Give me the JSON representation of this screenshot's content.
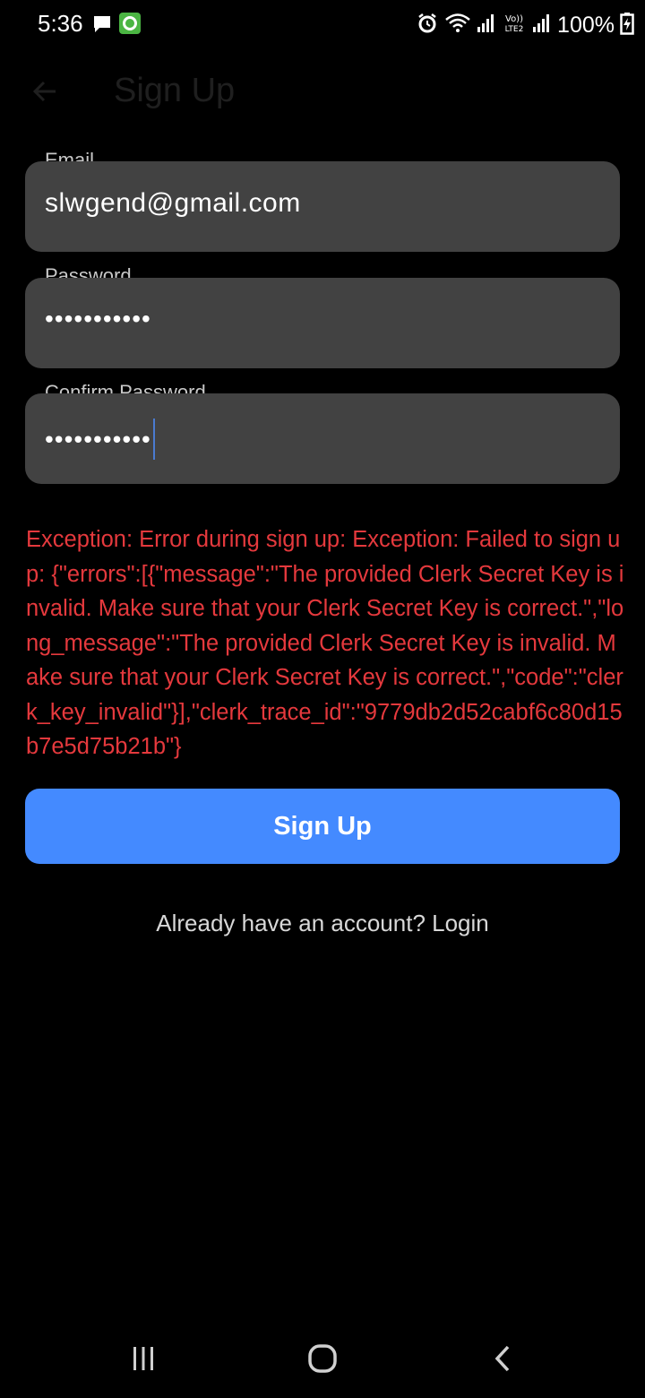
{
  "status_bar": {
    "time": "5:36",
    "battery": "100%",
    "icons": [
      "message-icon",
      "app-notification-icon",
      "alarm-icon",
      "wifi-icon",
      "signal-icon",
      "volte-icon",
      "signal-icon-2",
      "battery-charging-icon"
    ]
  },
  "app_bar": {
    "back_icon": "arrow-left-icon",
    "title": "Sign Up"
  },
  "form": {
    "email_label": "Email",
    "email_value": "slwgend@gmail.com",
    "password_label": "Password",
    "password_value": "•••••••••••",
    "confirm_label": "Confirm Password",
    "confirm_value": "•••••••••••"
  },
  "error": {
    "message": "Exception: Error during sign up: Exception: Failed to sign up: {\"errors\":[{\"message\":\"The provided Clerk Secret Key is invalid. Make sure that your Clerk Secret Key is correct.\",\"long_message\":\"The provided Clerk Secret Key is invalid. Make sure that your Clerk Secret Key is correct.\",\"code\":\"clerk_key_invalid\"}],\"clerk_trace_id\":\"9779db2d52cabf6c80d15b7e5d75b21b\"}"
  },
  "actions": {
    "signup_label": "Sign Up",
    "login_prompt": "Already have an account? Login"
  },
  "nav_bar": {
    "icons": [
      "recent-apps-icon",
      "home-icon",
      "back-icon"
    ]
  },
  "colors": {
    "background": "#000000",
    "field_bg": "#424242",
    "error": "#e5393d",
    "primary": "#448aff",
    "caret": "#4a7bd0"
  }
}
